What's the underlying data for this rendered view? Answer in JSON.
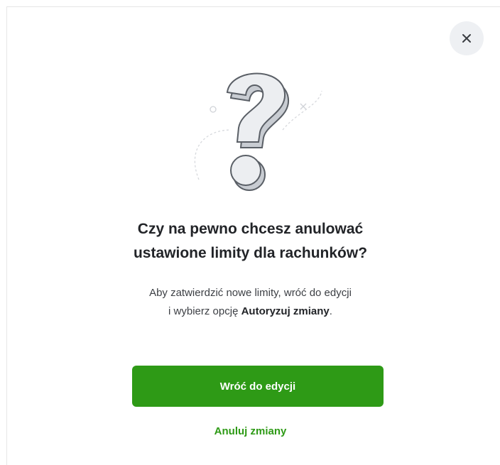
{
  "dialog": {
    "title_line1": "Czy na pewno chcesz anulować",
    "title_line2": "ustawione limity dla rachunków?",
    "desc_line1": "Aby zatwierdzić nowe limity, wróć do edycji",
    "desc_line2_prefix": "i wybierz opcję ",
    "desc_line2_bold": "Autoryzuj zmiany",
    "desc_line2_suffix": ".",
    "primary_button_label": "Wróć do edycji",
    "secondary_link_label": "Anuluj zmiany",
    "close_icon": "close-icon",
    "illustration_icon": "question-mark-icon"
  },
  "colors": {
    "accent": "#2e9a16",
    "close_bg": "#eef0f3",
    "title": "#222428"
  }
}
